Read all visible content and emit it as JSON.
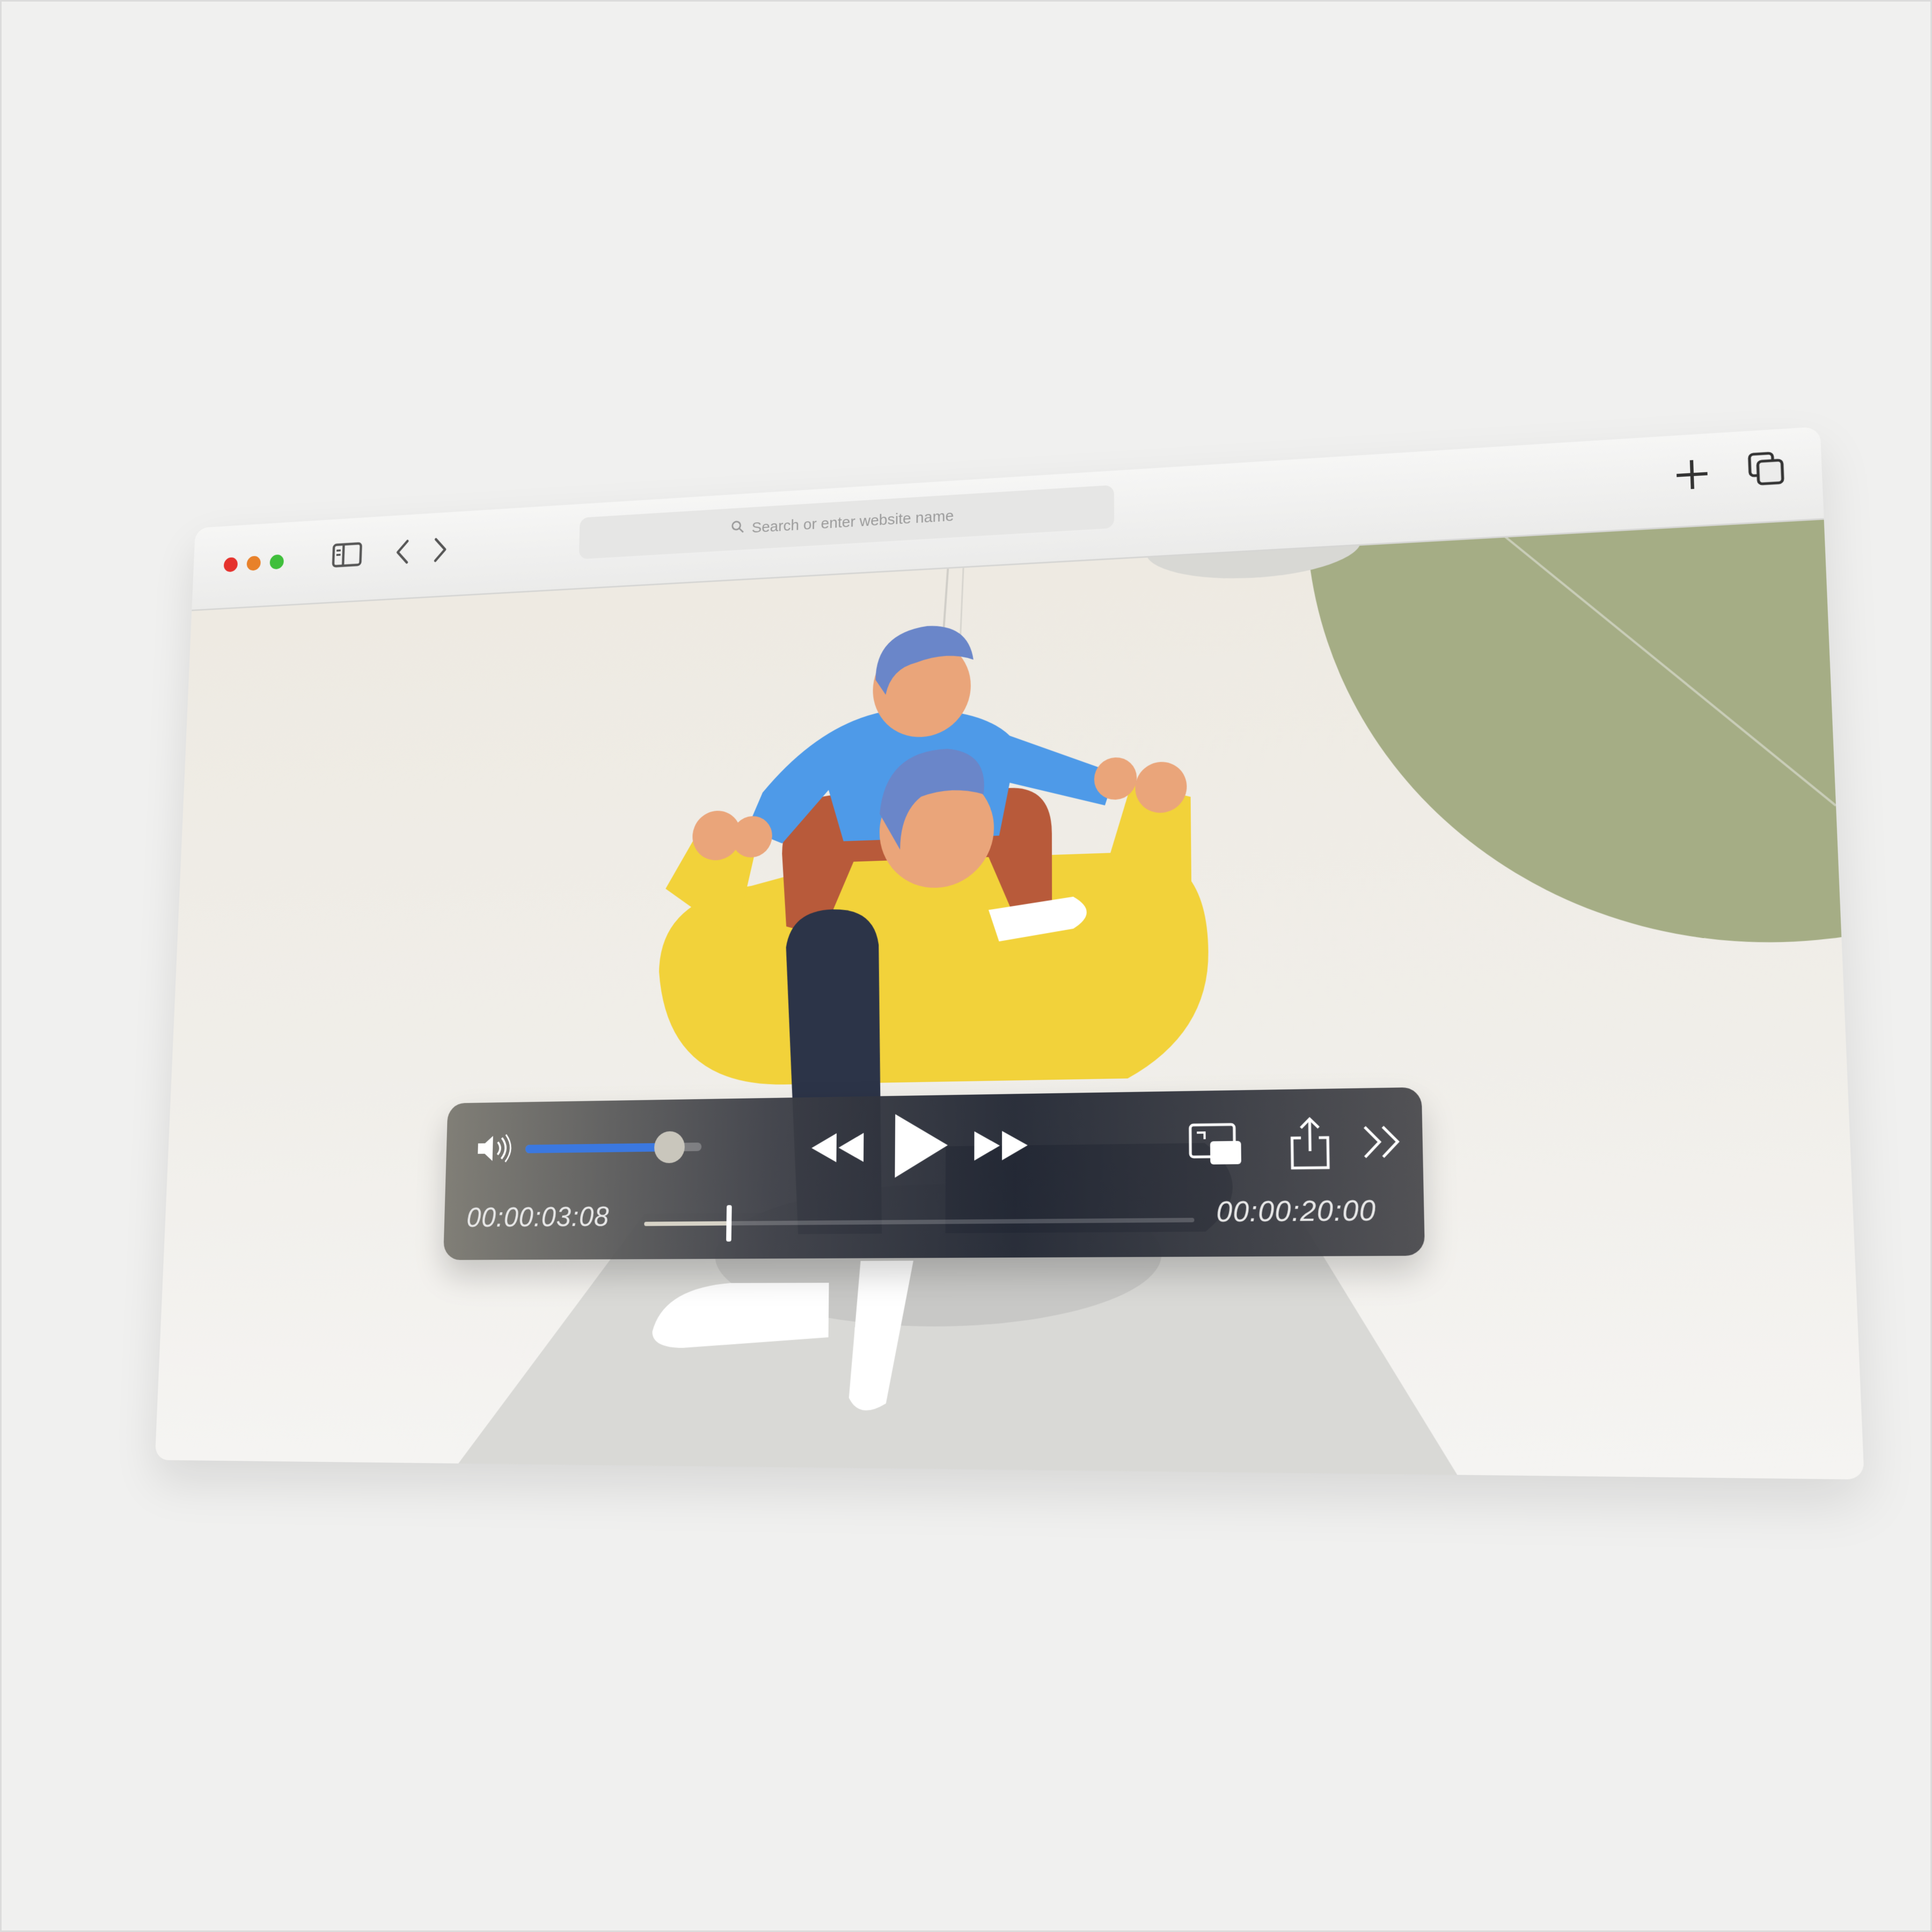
{
  "window": {
    "traffic_lights": {
      "close": "#e5322d",
      "minimize": "#e8812a",
      "zoom": "#3fbf3b"
    },
    "icons": [
      "sidebar-icon",
      "back-chevron-icon",
      "forward-chevron-icon",
      "new-tab-plus-icon",
      "tab-overview-icon"
    ]
  },
  "address_bar": {
    "placeholder": "Search or enter website name",
    "icon": "search-icon"
  },
  "video": {
    "illustration": "parent carrying child on shoulders",
    "colors": {
      "yellow": "#f2d23a",
      "blue": "#4e9ae8",
      "rust": "#b85a3a",
      "navy": "#2c3448",
      "green": "#a5ad85"
    }
  },
  "player": {
    "volume_level": 0.82,
    "progress": 0.16,
    "elapsed": "00:00:03:08",
    "duration": "00:00:20:00",
    "icons": [
      "volume-icon",
      "rewind-icon",
      "play-icon",
      "fast-forward-icon",
      "picture-in-picture-icon",
      "share-icon",
      "more-chevrons-icon"
    ],
    "accent": "#3b78e0"
  }
}
